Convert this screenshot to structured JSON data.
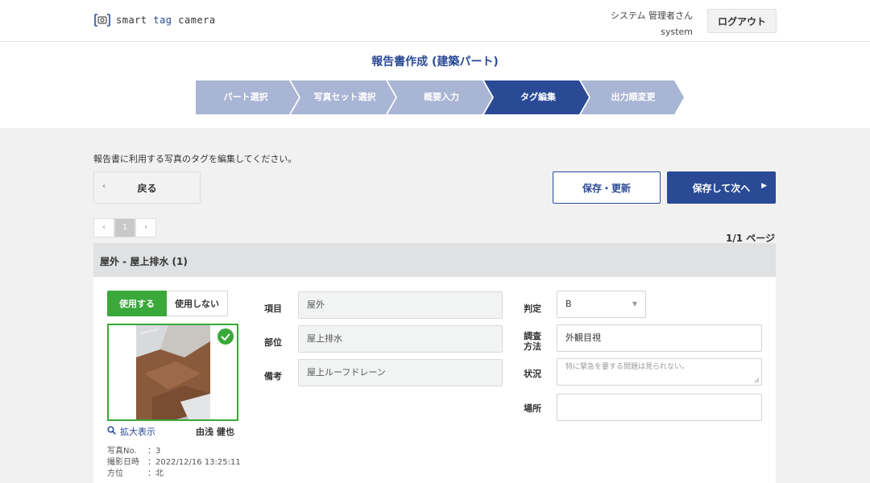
{
  "header": {
    "logo_prefix": "smart",
    "logo_tag": "tag",
    "logo_suffix": "camera",
    "user_name": "システム 管理者さん",
    "user_id": "system",
    "logout_label": "ログアウト"
  },
  "page": {
    "title": "報告書作成 (建築パート)",
    "steps": [
      "パート選択",
      "写真セット選択",
      "概要入力",
      "タグ編集",
      "出力順変更"
    ],
    "active_step_index": 3
  },
  "toolbar": {
    "instruction": "報告書に利用する写真のタグを編集してください。",
    "back_label": "戻る",
    "save_label": "保存・更新",
    "next_label": "保存して次へ"
  },
  "pagination": {
    "prev": "‹",
    "current": "1",
    "next": "›",
    "page_count": "1/1 ページ"
  },
  "section": {
    "title": "屋外 - 屋上排水 (1)"
  },
  "photo_card": {
    "use_label": "使用する",
    "not_use_label": "使用しない",
    "zoom_label": "拡大表示",
    "photographer": "由浅 健也",
    "meta": [
      {
        "key": "写真No.",
        "value": "：3"
      },
      {
        "key": "撮影日時",
        "value": "：2022/12/16 13:25:11"
      },
      {
        "key": "方位",
        "value": "：北"
      }
    ]
  },
  "form": {
    "item_label": "項目",
    "item_value": "屋外",
    "part_label": "部位",
    "part_value": "屋上排水",
    "note_label": "備考",
    "note_value": "屋上ルーフドレーン",
    "judge_label": "判定",
    "judge_value": "B",
    "method_label_1": "調査",
    "method_label_2": "方法",
    "method_value": "外観目視",
    "status_label": "状況",
    "status_placeholder": "特に緊急を要する問題は見られない。",
    "place_label": "場所",
    "place_value": ""
  },
  "colors": {
    "brand_blue": "#2a4a96",
    "step_inactive": "#a9b5d4",
    "step_active": "#2a4a96",
    "green": "#3aa83a"
  }
}
